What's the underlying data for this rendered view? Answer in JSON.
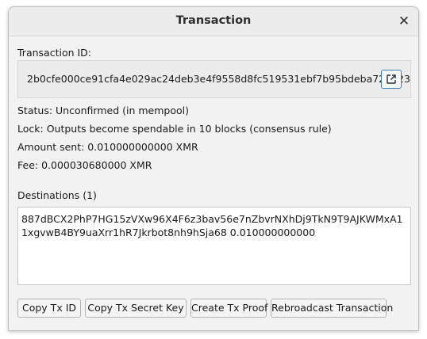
{
  "window": {
    "title": "Transaction",
    "close_icon": "close-icon"
  },
  "transaction": {
    "id_label": "Transaction ID:",
    "id_value": "2b0cfe000ce91cfa4e029ac24deb3e4f9558d8fc519531ebf7b95bdeba728b23",
    "open_icon": "external-link-icon",
    "status": "Status: Unconfirmed (in mempool)",
    "lock": "Lock: Outputs become spendable in 10 blocks (consensus rule)",
    "amount": "Amount sent: 0.010000000000 XMR",
    "fee": "Fee: 0.000030680000 XMR"
  },
  "destinations": {
    "label": "Destinations (1)",
    "text": "887dBCX2PhP7HG15zVXw96X4F6z3bav56e7nZbvrNXhDj9TkN9T9AJKWMxA11xgvwB4BY9uaXrr1hR7Jkrbot8nh9hSja68 0.010000000000"
  },
  "buttons": {
    "copy_txid": "Copy Tx ID",
    "copy_secret": "Copy Tx Secret Key",
    "create_proof": "Create Tx Proof",
    "rebroadcast": "Rebroadcast Transaction"
  },
  "colors": {
    "accent": "#3c7fc2",
    "window_bg": "#f2f2f2"
  }
}
